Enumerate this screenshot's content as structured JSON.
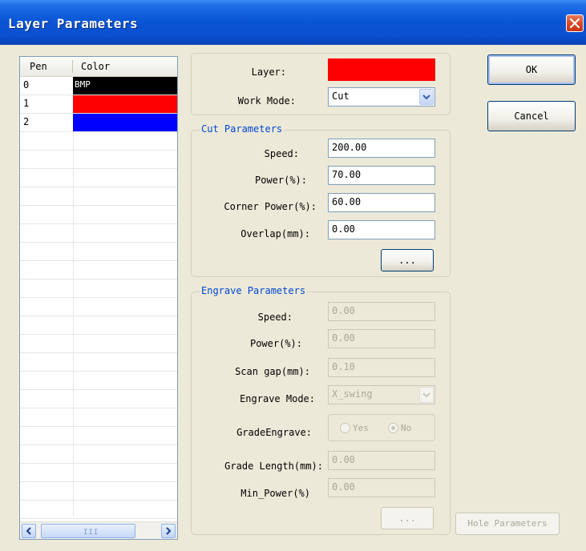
{
  "window": {
    "title": "Layer Parameters"
  },
  "list": {
    "headers": {
      "pen": "Pen",
      "color": "Color"
    },
    "rows": [
      {
        "pen": "0",
        "label": "BMP",
        "color": "#000000"
      },
      {
        "pen": "1",
        "label": "",
        "color": "#ff0000"
      },
      {
        "pen": "2",
        "label": "",
        "color": "#0000ff"
      }
    ],
    "scroll_grip": "III"
  },
  "layer": {
    "layer_label": "Layer:",
    "layer_color": "#ff0000",
    "work_mode_label": "Work Mode:",
    "work_mode_value": "Cut"
  },
  "cut": {
    "legend": "Cut Parameters",
    "speed_label": "Speed:",
    "speed_value": "200.00",
    "power_label": "Power(%):",
    "power_value": "70.00",
    "corner_power_label": "Corner Power(%):",
    "corner_power_value": "60.00",
    "overlap_label": "Overlap(mm):",
    "overlap_value": "0.00",
    "more_button": "..."
  },
  "engrave": {
    "legend": "Engrave Parameters",
    "speed_label": "Speed:",
    "speed_value": "0.00",
    "power_label": "Power(%):",
    "power_value": "0.00",
    "scan_gap_label": "Scan gap(mm):",
    "scan_gap_value": "0.10",
    "mode_label": "Engrave Mode:",
    "mode_value": "X_swing",
    "grade_label": "GradeEngrave:",
    "grade_yes": "Yes",
    "grade_no": "No",
    "grade_length_label": "Grade Length(mm):",
    "grade_length_value": "0.00",
    "min_power_label": "Min_Power(%)",
    "min_power_value": "0.00",
    "more_button": "..."
  },
  "buttons": {
    "ok": "OK",
    "cancel": "Cancel",
    "hole_parameters": "Hole Parameters"
  }
}
